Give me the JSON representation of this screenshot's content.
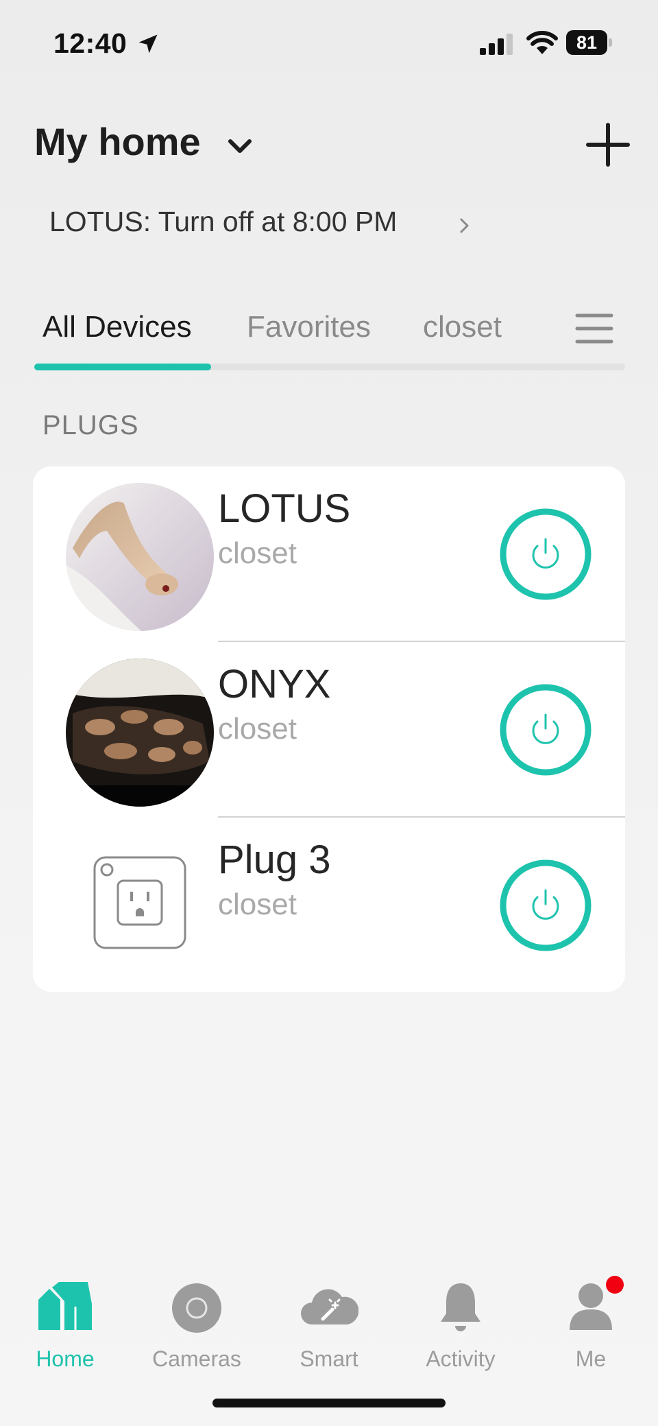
{
  "status_bar": {
    "time": "12:40",
    "battery": "81"
  },
  "header": {
    "title": "My home",
    "schedule": "LOTUS: Turn off at 8:00 PM"
  },
  "tabs": [
    {
      "label": "All Devices",
      "active": true
    },
    {
      "label": "Favorites",
      "active": false
    },
    {
      "label": "closet",
      "active": false
    }
  ],
  "section_title": "PLUGS",
  "devices": [
    {
      "name": "LOTUS",
      "room": "closet",
      "icon": "snake-photo"
    },
    {
      "name": "ONYX",
      "room": "closet",
      "icon": "snake-photo"
    },
    {
      "name": "Plug 3",
      "room": "closet",
      "icon": "plug-outlet-icon"
    }
  ],
  "nav": [
    {
      "label": "Home",
      "active": true
    },
    {
      "label": "Cameras",
      "active": false
    },
    {
      "label": "Smart",
      "active": false
    },
    {
      "label": "Activity",
      "active": false
    },
    {
      "label": "Me",
      "active": false
    }
  ],
  "colors": {
    "accent": "#1ec3ad",
    "badge": "#f00010"
  }
}
